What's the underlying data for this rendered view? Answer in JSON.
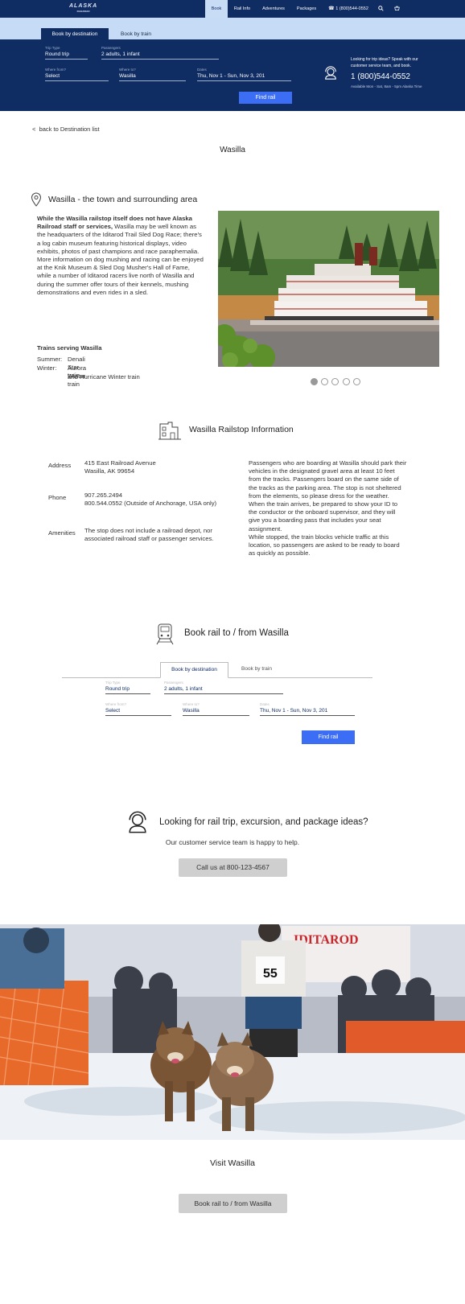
{
  "nav": {
    "logo_text": "ALASKA",
    "logo_sub": "RAILROAD",
    "items": [
      {
        "label": "Book"
      },
      {
        "label": "Rail Info"
      },
      {
        "label": "Adventures"
      },
      {
        "label": "Packages"
      },
      {
        "label": "1 (800)544-0552"
      }
    ]
  },
  "booking": {
    "tabs": [
      "Book by destination",
      "Book by train"
    ],
    "trip_type_label": "Trip Type",
    "trip_type_value": "Round trip",
    "passengers_label": "Passengers",
    "passengers_value": "2 adults, 1 infant",
    "from_label": "Where from?",
    "from_value": "Select",
    "to_label": "Where to?",
    "to_value": "Wasilla",
    "dates_label": "Dates",
    "dates_value_top": "Thu, Nov 1 - Sun, Nov 3, 201",
    "dates_value": "Thu, Nov 1 - Sun, Nov 3, 201",
    "submit": "Find rail"
  },
  "help": {
    "text": "Looking for trip ideas? Speak with our customer service team, and book.",
    "phone": "1 (800)544-0552",
    "hours": "Available Mon - Sat, 8am - 5pm Alaska Time"
  },
  "back_link": "back to Destination list",
  "page_title": "Wasilla",
  "town": {
    "heading": "Wasilla - the town and surrounding area",
    "intro_bold": "While the Wasilla railstop itself does not have Alaska Railroad staff or services,",
    "intro_rest": " Wasilla may be well known as the headquarters of the Iditarod Trail Sled Dog Race; there's a log cabin museum featuring historical displays, video exhibits, photos of past champions and race paraphernalia. More information on dog mushing and racing can be enjoyed at the Knik Museum & Sled Dog Musher's Hall of Fame, while a number of Iditarod racers live north of Wasilla and during the summer offer tours of their kennels, mushing demonstrations and even rides in a sled.",
    "trains_heading": "Trains serving Wasilla",
    "summer_label": "Summer:",
    "summer_value": "Denali Star train",
    "winter_label": "Winter:",
    "winter_value_1": "Aurora Winter train",
    "winter_value_2": "and Hurricane Winter train"
  },
  "railstop": {
    "heading": "Wasilla Railstop Information",
    "address_label": "Address",
    "address_1": "415 East Railroad Avenue",
    "address_2": "Wasilla, AK 99654",
    "phone_label": "Phone",
    "phone_1": "907.265.2494",
    "phone_2": "800.544.0552 (Outside of Anchorage, USA only)",
    "amenities_label": "Amenities",
    "amenities_text": "The stop does not include a railroad depot, nor associated railroad staff or passenger services.",
    "notes": "Passengers who are boarding at Wasilla should park their vehicles in the designated gravel area at least 10 feet from the tracks. Passengers board on the same side of the tracks as the parking area. The stop is not sheltered from the elements, so please dress for the weather.\nWhen the train arrives, be prepared to show your ID to the conductor or the onboard supervisor, and they will give you a boarding pass that includes your seat assignment.\nWhile stopped, the train blocks vehicle traffic at this location, so passengers are asked to be ready to board as quickly as possible."
  },
  "book_section": {
    "heading": "Book rail to / from Wasilla"
  },
  "ideas": {
    "heading": "Looking for rail trip, excursion, and package ideas?",
    "sub": "Our customer service team is happy to help.",
    "button": "Call us at 800-123-4567"
  },
  "photo": {
    "bib_number": "55",
    "banner_text": "IDITAROD"
  },
  "visit": {
    "heading": "Visit Wasilla",
    "button": "Book rail to / from Wasilla"
  },
  "colors": {
    "navy": "#0f2c63",
    "light_blue": "#c5dbf6",
    "button_blue": "#3b6ef5"
  }
}
